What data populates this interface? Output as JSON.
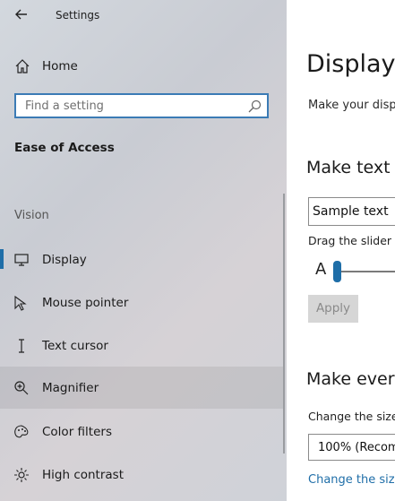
{
  "window": {
    "title": "Settings"
  },
  "sidebar": {
    "home_label": "Home",
    "search_placeholder": "Find a setting",
    "section_title": "Ease of Access",
    "group_title": "Vision",
    "items": [
      {
        "label": "Display",
        "icon": "monitor-icon",
        "selected": true
      },
      {
        "label": "Mouse pointer",
        "icon": "mouse-pointer-icon"
      },
      {
        "label": "Text cursor",
        "icon": "text-cursor-icon"
      },
      {
        "label": "Magnifier",
        "icon": "magnifier-icon",
        "hover": true
      },
      {
        "label": "Color filters",
        "icon": "color-filters-icon"
      },
      {
        "label": "High contrast",
        "icon": "high-contrast-icon"
      }
    ]
  },
  "content": {
    "title": "Display",
    "subtitle": "Make your displ",
    "text_bigger_heading": "Make text b",
    "sample_text": "Sample text",
    "slider_hint": "Drag the slider u",
    "slider_letter": "A",
    "apply_label": "Apply",
    "everything_heading": "Make every",
    "change_size_label": "Change the size",
    "scale_value": "100% (Recomm",
    "change_link": "Change the size"
  },
  "colors": {
    "accent": "#1f6ea8",
    "search_border": "#3b7bb5"
  }
}
